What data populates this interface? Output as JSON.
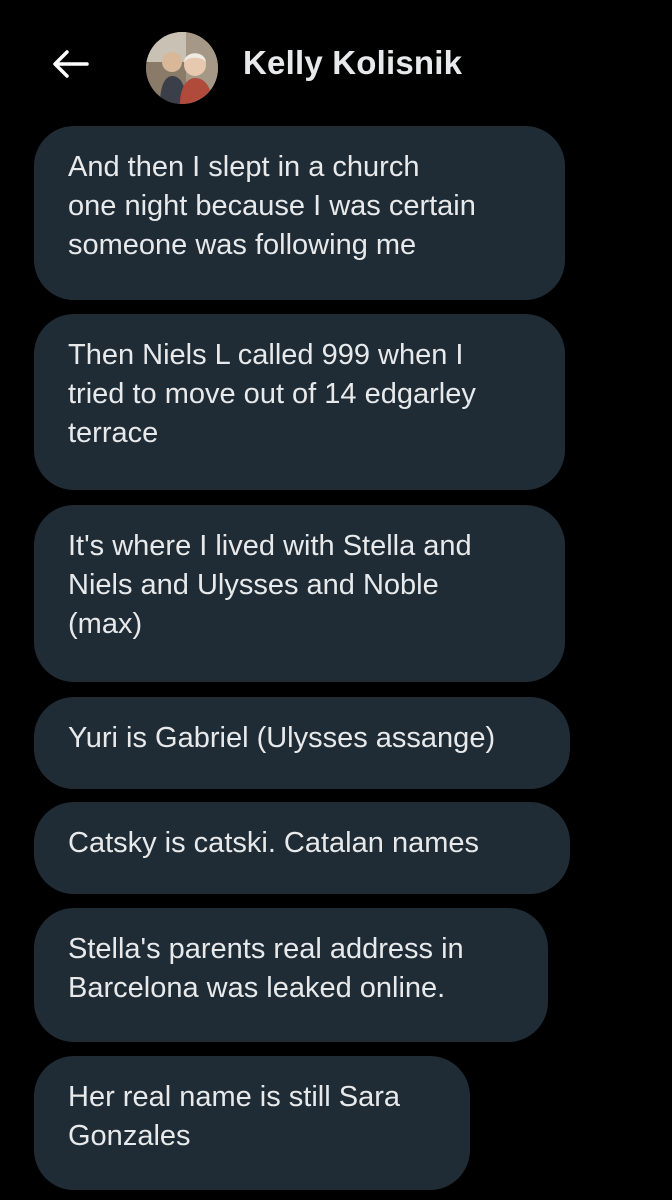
{
  "header": {
    "back_icon": "arrow-left-icon",
    "contact_name": "Kelly Kolisnik"
  },
  "messages": [
    {
      "text": "And then I slept in a church\none night because I was certain\nsomeone was following me"
    },
    {
      "text": "Then Niels L called 999 when I\ntried to move out of 14 edgarley\nterrace"
    },
    {
      "text": "It's where I lived with Stella and\nNiels and Ulysses and Noble\n(max)"
    },
    {
      "text": "Yuri is Gabriel (Ulysses assange)"
    },
    {
      "text": "Catsky is catski. Catalan names"
    },
    {
      "text": "Stella's parents real address in\nBarcelona was leaked online."
    },
    {
      "text": "Her real name is still Sara\nGonzales"
    }
  ],
  "colors": {
    "background": "#000000",
    "bubble": "#202c35",
    "text": "#e7e9ea"
  }
}
